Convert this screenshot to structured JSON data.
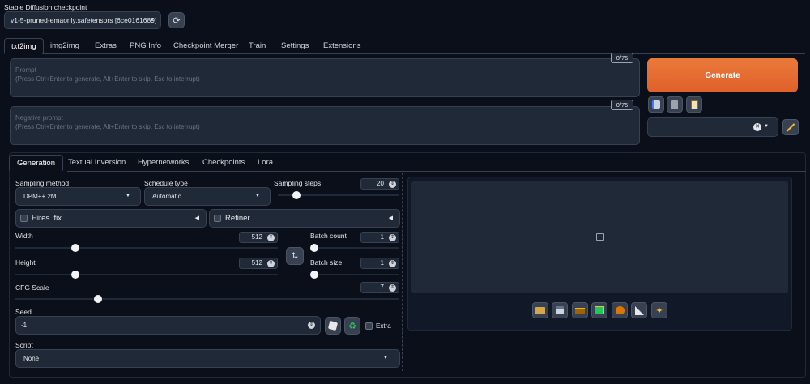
{
  "checkpoint": {
    "label": "Stable Diffusion checkpoint",
    "value": "v1-5-pruned-emaonly.safetensors [6ce0161689]"
  },
  "main_tabs": [
    "txt2img",
    "img2img",
    "Extras",
    "PNG Info",
    "Checkpoint Merger",
    "Train",
    "Settings",
    "Extensions"
  ],
  "prompt": {
    "label": "Prompt",
    "placeholder": "(Press Ctrl+Enter to generate, Alt+Enter to skip, Esc to interrupt)",
    "counter": "0/75"
  },
  "negative_prompt": {
    "label": "Negative prompt",
    "placeholder": "(Press Ctrl+Enter to generate, Alt+Enter to skip, Esc to interrupt)",
    "counter": "0/75"
  },
  "generate_label": "Generate",
  "sub_tabs": [
    "Generation",
    "Textual Inversion",
    "Hypernetworks",
    "Checkpoints",
    "Lora"
  ],
  "sampling_method": {
    "label": "Sampling method",
    "value": "DPM++ 2M"
  },
  "schedule_type": {
    "label": "Schedule type",
    "value": "Automatic"
  },
  "sampling_steps": {
    "label": "Sampling steps",
    "value": "20",
    "fraction": 0.13
  },
  "hires_fix": {
    "label": "Hires. fix"
  },
  "refiner": {
    "label": "Refiner"
  },
  "width": {
    "label": "Width",
    "value": "512",
    "fraction": 0.22
  },
  "height": {
    "label": "Height",
    "value": "512",
    "fraction": 0.22
  },
  "batch_count": {
    "label": "Batch count",
    "value": "1",
    "fraction": 0.0
  },
  "batch_size": {
    "label": "Batch size",
    "value": "1",
    "fraction": 0.0
  },
  "cfg_scale": {
    "label": "CFG Scale",
    "value": "7",
    "fraction": 0.21
  },
  "seed": {
    "label": "Seed",
    "value": "-1",
    "extra_label": "Extra"
  },
  "script": {
    "label": "Script",
    "value": "None"
  },
  "colors": {
    "accent": "#e8692b",
    "background": "#0b0f19",
    "panel": "#1f2937"
  }
}
